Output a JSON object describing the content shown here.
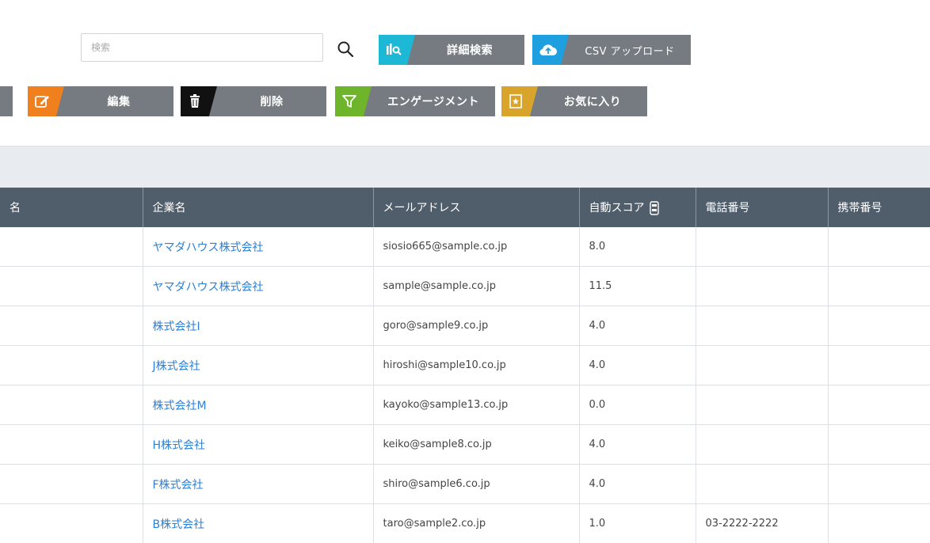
{
  "search": {
    "placeholder": "検索"
  },
  "top_buttons": {
    "detail_search": "詳細検索",
    "csv_upload": "CSV アップロード"
  },
  "action_buttons": {
    "edit": "編集",
    "delete": "削除",
    "engagement": "エンゲージメント",
    "favorite": "お気に入り"
  },
  "colors": {
    "detail_accent": "#1db8d6",
    "csv_accent": "#1e9fe0",
    "edit_accent": "#f07f1e",
    "delete_accent": "#111111",
    "engagement_accent": "#6fb52c",
    "favorite_accent": "#d9a42b",
    "button_gray": "#757b80",
    "header_bg": "#505d6b",
    "link": "#2a7fd6"
  },
  "table": {
    "columns": [
      "名",
      "企業名",
      "メールアドレス",
      "自動スコア",
      "電話番号",
      "携帯番号"
    ],
    "rows": [
      {
        "name": "",
        "company": "ヤマダハウス株式会社",
        "email": "siosio665@sample.co.jp",
        "score": "8.0",
        "phone": "",
        "mobile": ""
      },
      {
        "name": "",
        "company": "ヤマダハウス株式会社",
        "email": "sample@sample.co.jp",
        "score": "11.5",
        "phone": "",
        "mobile": ""
      },
      {
        "name": "",
        "company": "株式会社I",
        "email": "goro@sample9.co.jp",
        "score": "4.0",
        "phone": "",
        "mobile": ""
      },
      {
        "name": "",
        "company": "J株式会社",
        "email": "hiroshi@sample10.co.jp",
        "score": "4.0",
        "phone": "",
        "mobile": ""
      },
      {
        "name": "",
        "company": "株式会社M",
        "email": "kayoko@sample13.co.jp",
        "score": "0.0",
        "phone": "",
        "mobile": ""
      },
      {
        "name": "",
        "company": "H株式会社",
        "email": "keiko@sample8.co.jp",
        "score": "4.0",
        "phone": "",
        "mobile": ""
      },
      {
        "name": "",
        "company": "F株式会社",
        "email": "shiro@sample6.co.jp",
        "score": "4.0",
        "phone": "",
        "mobile": ""
      },
      {
        "name": "",
        "company": "B株式会社",
        "email": "taro@sample2.co.jp",
        "score": "1.0",
        "phone": "03-2222-2222",
        "mobile": ""
      }
    ]
  }
}
